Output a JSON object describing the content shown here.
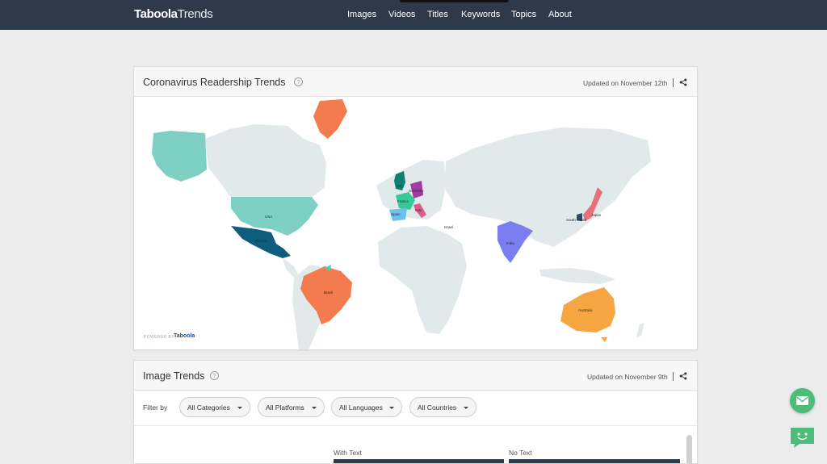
{
  "brand": {
    "name_bold": "Taboola",
    "name_light": "Trends"
  },
  "nav": {
    "items": [
      "Images",
      "Videos",
      "Titles",
      "Keywords",
      "Topics",
      "About"
    ]
  },
  "readership": {
    "title": "Coronavirus Readership Trends",
    "help": "?",
    "updated": "Updated on November 12th",
    "powered_by": "POWERED BY",
    "powered_logo": "Taboola",
    "countries": [
      "UK",
      "Germany",
      "France",
      "Spain",
      "Italy",
      "USA",
      "Mexico",
      "Brazil",
      "India",
      "South Korea",
      "Japan",
      "Australia",
      "Israel"
    ]
  },
  "image_trends": {
    "title": "Image Trends",
    "help": "?",
    "updated": "Updated on November 9th",
    "filter_label": "Filter by",
    "filters": [
      "All Categories",
      "All Platforms",
      "All Languages",
      "All Countries"
    ],
    "columns": [
      "With Text",
      "No Text"
    ]
  },
  "colors": {
    "navbar": "#2e3a4a",
    "land": "#e2e9ea",
    "usa": "#7ecfc4",
    "mexico": "#0f5d7e",
    "brazil": "#f47b4d",
    "india": "#7b7ef0",
    "australia": "#f6a640",
    "fab": "#4cbc78"
  },
  "icons": [
    "help-icon",
    "share-icon",
    "mail-icon",
    "chatbot-icon",
    "caret-down-icon"
  ]
}
